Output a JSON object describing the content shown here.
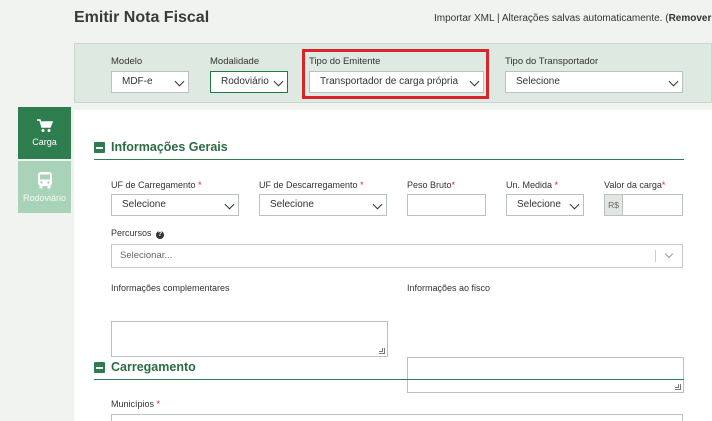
{
  "header": {
    "title": "Emitir Nota Fiscal",
    "import_xml": "Importar XML",
    "separator": " | ",
    "autosave": "Alterações salvas automaticamente. (",
    "remove": "Remover alteraç"
  },
  "filters": {
    "modelo": {
      "label": "Modelo",
      "value": "MDF-e"
    },
    "modalidade": {
      "label": "Modalidade",
      "value": "Rodoviário"
    },
    "tipo_emitente": {
      "label": "Tipo do Emitente",
      "value": "Transportador de carga própria"
    },
    "tipo_transportador": {
      "label": "Tipo do Transportador",
      "value": "Selecione"
    }
  },
  "sidebar": {
    "items": [
      {
        "label": "Carga",
        "icon": "cart-icon",
        "active": true
      },
      {
        "label": "Rodoviário",
        "icon": "bus-icon",
        "active": false
      }
    ]
  },
  "info_gerais": {
    "title": "Informações Gerais",
    "uf_carregamento": {
      "label": "UF de Carregamento",
      "value": "Selecione"
    },
    "uf_descarregamento": {
      "label": "UF de Descarregamento",
      "value": "Selecione"
    },
    "peso_bruto": {
      "label": "Peso Bruto",
      "value": ""
    },
    "un_medida": {
      "label": "Un. Medida",
      "value": "Selecione"
    },
    "valor_carga": {
      "label": "Valor da carga",
      "prefix": "R$",
      "value": ""
    },
    "percursos": {
      "label": "Percursos",
      "placeholder": "Selecionar..."
    },
    "info_complementares": {
      "label": "Informações complementares"
    },
    "info_fisco": {
      "label": "Informações ao fisco"
    }
  },
  "carregamento": {
    "title": "Carregamento",
    "municipios": {
      "label": "Municípios"
    }
  },
  "required_mark": "*",
  "colors": {
    "primary": "#2e7d4f",
    "band": "#dde9e1",
    "highlight": "#d9252a"
  }
}
